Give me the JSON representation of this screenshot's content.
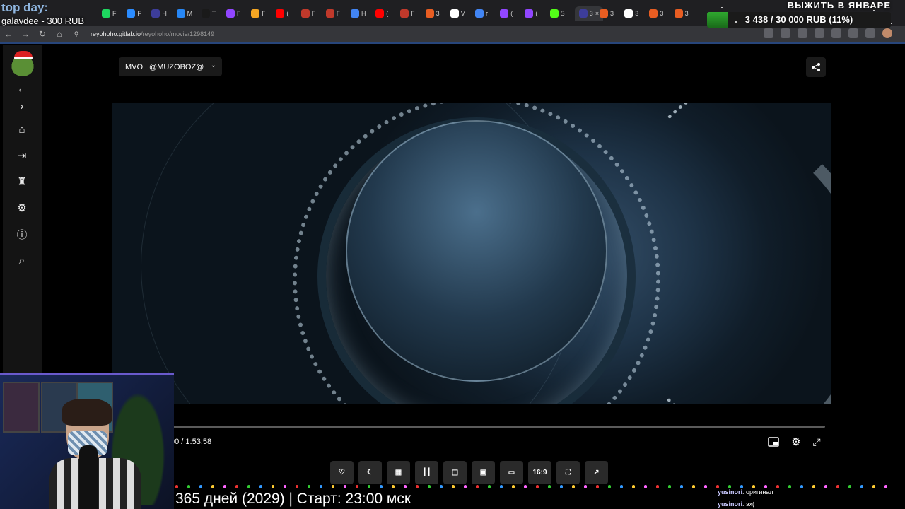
{
  "browser": {
    "tabs": [
      {
        "label": "F",
        "color": "#1ed760"
      },
      {
        "label": "F",
        "color": "#2b8cff"
      },
      {
        "label": "H",
        "color": "#3d3d9a"
      },
      {
        "label": "M",
        "color": "#2787f5"
      },
      {
        "label": "T",
        "color": "#1a1a1a"
      },
      {
        "label": "Г",
        "color": "#9146ff"
      },
      {
        "label": "Г",
        "color": "#f5a623"
      },
      {
        "label": "(",
        "color": "#ff0000"
      },
      {
        "label": "Г",
        "color": "#c0392b"
      },
      {
        "label": "Г",
        "color": "#c0392b"
      },
      {
        "label": "H",
        "color": "#4285f4"
      },
      {
        "label": "(",
        "color": "#ff0000"
      },
      {
        "label": "Г",
        "color": "#c0392b"
      },
      {
        "label": "3",
        "color": "#e85d22"
      },
      {
        "label": "V",
        "color": "#ffffff"
      },
      {
        "label": "г",
        "color": "#4285f4"
      },
      {
        "label": "(",
        "color": "#9146ff"
      },
      {
        "label": "(",
        "color": "#9146ff"
      },
      {
        "label": "S",
        "color": "#53fc18"
      },
      {
        "label": "3",
        "color": "#3d3d9a",
        "active": true
      },
      {
        "label": "3",
        "color": "#e85d22"
      },
      {
        "label": "3",
        "color": "#ffffff"
      },
      {
        "label": "3",
        "color": "#e85d22"
      },
      {
        "label": "3",
        "color": "#e85d22"
      }
    ],
    "url_host": "reyohoho.gitlab.io",
    "url_path": "/reyohoho/movie/1298149"
  },
  "overlay": {
    "top_day_label": "top day:",
    "top_donor": "galavdee - 300 RUB",
    "goal_title": "ВЫЖИТЬ В ЯНВАРЕ",
    "goal_text": "3 438 / 30 000 RUB (11%)",
    "goal_progress": 0.11,
    "ticker": "365 дней (2029) | Старт: 23:00 мск",
    "chat": [
      {
        "user": "yusinori",
        "message": ": оригинал"
      },
      {
        "user": "yusinori",
        "message": ": эх("
      }
    ]
  },
  "sidebar": {
    "items": [
      {
        "name": "back-arrow-icon",
        "glyph": "←"
      },
      {
        "name": "forward-chevron-icon",
        "glyph": "›"
      },
      {
        "name": "home-icon",
        "glyph": "⌂"
      },
      {
        "name": "login-icon",
        "glyph": "⇥"
      },
      {
        "name": "trophy-icon",
        "glyph": "♜"
      },
      {
        "name": "settings-gear-icon",
        "glyph": "⚙"
      },
      {
        "name": "info-icon",
        "glyph": "ⓘ"
      },
      {
        "name": "search-icon",
        "glyph": "⌕"
      }
    ]
  },
  "player": {
    "dub_selected": "MVO | @MUZOBOZ@",
    "time_display": "00 / 1:53:58",
    "controls": [
      {
        "name": "favorite-heart-button",
        "label": "♡"
      },
      {
        "name": "dark-mode-button",
        "label": "☾"
      },
      {
        "name": "blur-button",
        "label": "▦"
      },
      {
        "name": "audio-wave-button",
        "label": "┃┃"
      },
      {
        "name": "mirror-button",
        "label": "◫"
      },
      {
        "name": "theater-mode-button",
        "label": "▣"
      },
      {
        "name": "mini-player-button",
        "label": "▭"
      },
      {
        "name": "aspect-ratio-button",
        "label": "16:9"
      },
      {
        "name": "screenshot-button",
        "label": "⛶"
      },
      {
        "name": "open-external-button",
        "label": "↗"
      }
    ]
  }
}
